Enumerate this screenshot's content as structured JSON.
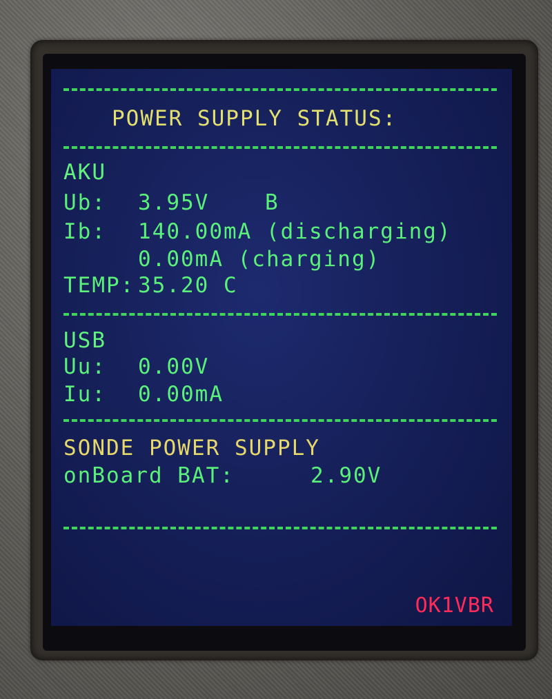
{
  "screen": {
    "title": "POWER SUPPLY STATUS:",
    "aku": {
      "heading": "AKU",
      "ub_label": "Ub:",
      "ub_value": "3.95V",
      "ub_flag": "B",
      "ib_label": "Ib:",
      "ib_discharging": "140.00mA (discharging)",
      "ib_charging": "0.00mA (charging)",
      "temp_label": "TEMP:",
      "temp_value": "35.20 C"
    },
    "usb": {
      "heading": "USB",
      "uu_label": "Uu:",
      "uu_value": "0.00V",
      "iu_label": "Iu:",
      "iu_value": "0.00mA"
    },
    "sonde": {
      "heading": "SONDE POWER SUPPLY",
      "bat_label": "onBoard BAT:",
      "bat_value": "2.90V"
    },
    "callsign": "OK1VBR"
  },
  "colors": {
    "screen_bg": "#16205a",
    "text_green": "#5bf07a",
    "title_yellow": "#e4e070",
    "callsign_red": "#ff2b5a"
  }
}
